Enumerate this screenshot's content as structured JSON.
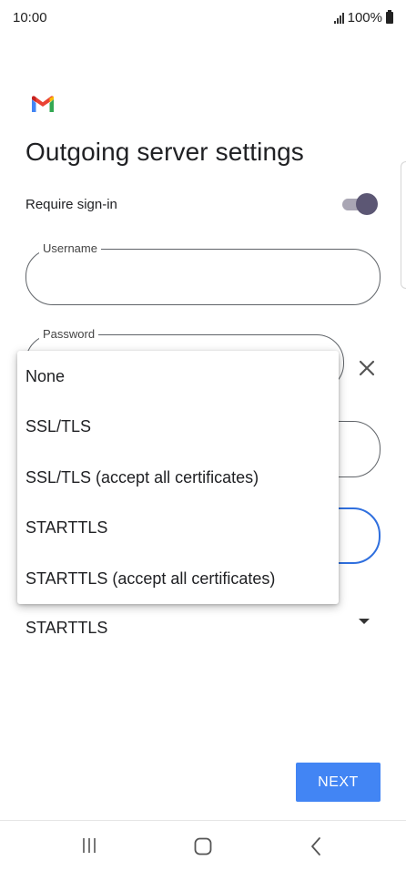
{
  "status_bar": {
    "time": "10:00",
    "battery": "100%"
  },
  "header": {
    "title": "Outgoing server settings"
  },
  "require_signin": {
    "label": "Require sign-in",
    "enabled": true
  },
  "fields": {
    "username_label": "Username",
    "password_label": "Password"
  },
  "security_menu": {
    "options": [
      "None",
      "SSL/TLS",
      "SSL/TLS (accept all certificates)",
      "STARTTLS",
      "STARTTLS (accept all certificates)"
    ],
    "selected": "STARTTLS"
  },
  "actions": {
    "next_label": "NEXT"
  },
  "colors": {
    "accent": "#4285f4",
    "toggle_thumb": "#5c5774",
    "focus_border": "#2f6fde"
  },
  "icons": [
    "gmail-logo",
    "signal-icon",
    "battery-icon",
    "clear-icon",
    "dropdown-caret-icon",
    "recents-icon",
    "home-icon",
    "back-icon"
  ]
}
